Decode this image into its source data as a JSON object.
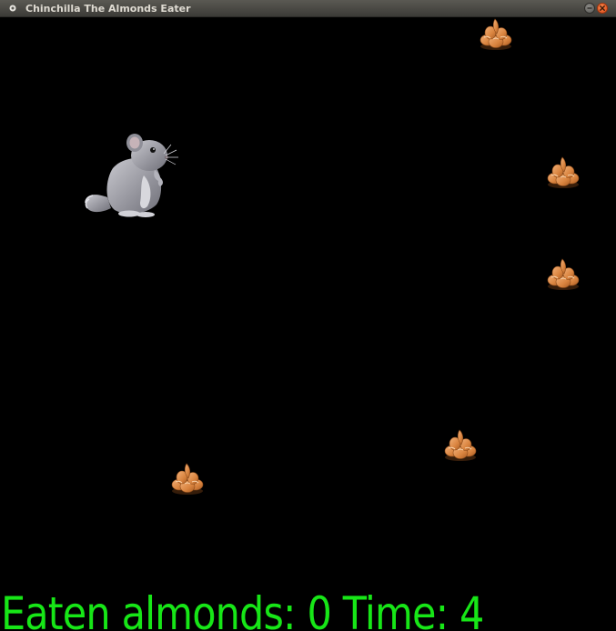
{
  "window": {
    "title": "Chinchilla The Almonds Eater"
  },
  "hud": {
    "eaten_label": "Eaten almonds:",
    "eaten_value": "0",
    "time_label": "Time:",
    "time_value": "4",
    "color": "#17e617"
  },
  "sprites": {
    "player": "chinchilla",
    "items": [
      "almond",
      "almond",
      "almond",
      "almond",
      "almond"
    ]
  },
  "icons": [
    "app-icon",
    "minimize-icon",
    "close-icon"
  ]
}
